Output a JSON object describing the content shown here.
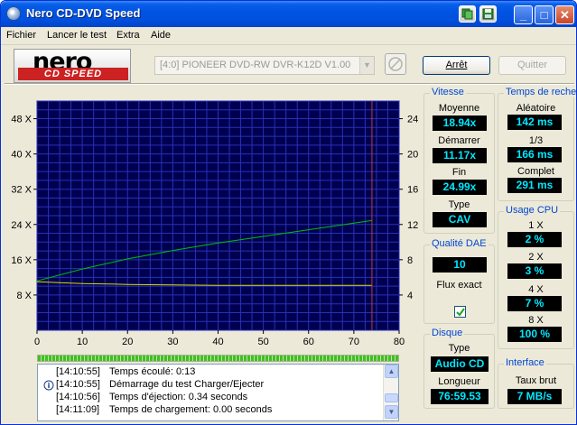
{
  "window": {
    "title": "Nero CD-DVD Speed"
  },
  "menu": [
    "Fichier",
    "Lancer le test",
    "Extra",
    "Aide"
  ],
  "toolbar": {
    "drive": "[4:0]  PIONEER DVD-RW  DVR-K12D V1.00",
    "stop_label": "Arrêt",
    "quit_label": "Quitter"
  },
  "logo": {
    "top": "nero",
    "bottom": "CD SPEED"
  },
  "chart_data": {
    "type": "line",
    "x": [
      0,
      10,
      20,
      30,
      40,
      50,
      60,
      70,
      74
    ],
    "xlim": [
      0,
      80
    ],
    "x_ticks": [
      "0",
      "10",
      "20",
      "30",
      "40",
      "50",
      "60",
      "70",
      "80"
    ],
    "ylim_left": [
      0,
      52
    ],
    "y_ticks_left": [
      "8 X",
      "16 X",
      "24 X",
      "32 X",
      "40 X",
      "48 X"
    ],
    "ylim_right": [
      0,
      26
    ],
    "y_ticks_right": [
      "4",
      "8",
      "12",
      "16",
      "20",
      "24"
    ],
    "series": [
      {
        "color": "#00c000",
        "values": [
          11.2,
          13.9,
          16.2,
          18.1,
          19.8,
          21.3,
          22.8,
          24.3,
          24.9
        ]
      },
      {
        "color": "#d8d800",
        "values": [
          11.0,
          10.6,
          10.4,
          10.3,
          10.2,
          10.2,
          10.2,
          10.2,
          10.2
        ]
      }
    ],
    "marker_x": 74,
    "grid": true,
    "colors": {
      "background": "#000050",
      "grid": "#2830b8",
      "marker": "#c04020"
    }
  },
  "log": [
    {
      "time": "[14:10:55]",
      "text": "Temps écoulé:  0:13"
    },
    {
      "time": "[14:10:55]",
      "text": "Démarrage du test Charger/Ejecter",
      "icon": "info-icon"
    },
    {
      "time": "[14:10:56]",
      "text": "Temps d'éjection: 0.34 seconds"
    },
    {
      "time": "[14:11:09]",
      "text": "Temps de chargement: 0.00 seconds"
    }
  ],
  "vitesse": {
    "title": "Vitesse",
    "moyenne_label": "Moyenne",
    "moyenne": "18.94x",
    "demarrer_label": "Démarrer",
    "demarrer": "11.17x",
    "fin_label": "Fin",
    "fin": "24.99x",
    "type_label": "Type",
    "type": "CAV"
  },
  "temps": {
    "title": "Temps de reche",
    "aleatoire_label": "Aléatoire",
    "aleatoire": "142 ms",
    "tiers_label": "1/3",
    "tiers": "166 ms",
    "complet_label": "Complet",
    "complet": "291 ms"
  },
  "dae": {
    "title": "Qualité DAE",
    "value": "10",
    "flux_label": "Flux exact",
    "flux_checked": true
  },
  "cpu": {
    "title": "Usage CPU",
    "items": [
      {
        "label": "1 X",
        "value": "2 %"
      },
      {
        "label": "2 X",
        "value": "3 %"
      },
      {
        "label": "4 X",
        "value": "7 %"
      },
      {
        "label": "8 X",
        "value": "100 %"
      }
    ]
  },
  "disque": {
    "title": "Disque",
    "type_label": "Type",
    "type": "Audio CD",
    "longueur_label": "Longueur",
    "longueur": "76:59.53"
  },
  "interface": {
    "title": "Interface",
    "taux_label": "Taux brut",
    "taux": "7 MB/s"
  }
}
